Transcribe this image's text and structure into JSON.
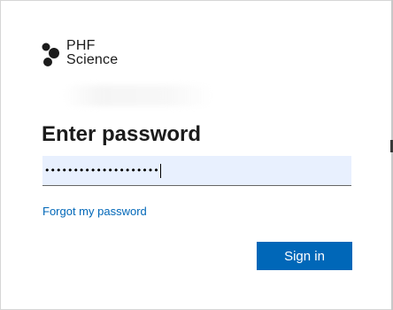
{
  "logo": {
    "line1": "PHF",
    "line2": "Science"
  },
  "heading": "Enter password",
  "password_field": {
    "masked_value": "••••••••••••••••••••"
  },
  "links": {
    "forgot": "Forgot my password"
  },
  "buttons": {
    "sign_in": "Sign in"
  },
  "colors": {
    "accent": "#0067b8",
    "field_background": "#e8f0fe"
  }
}
